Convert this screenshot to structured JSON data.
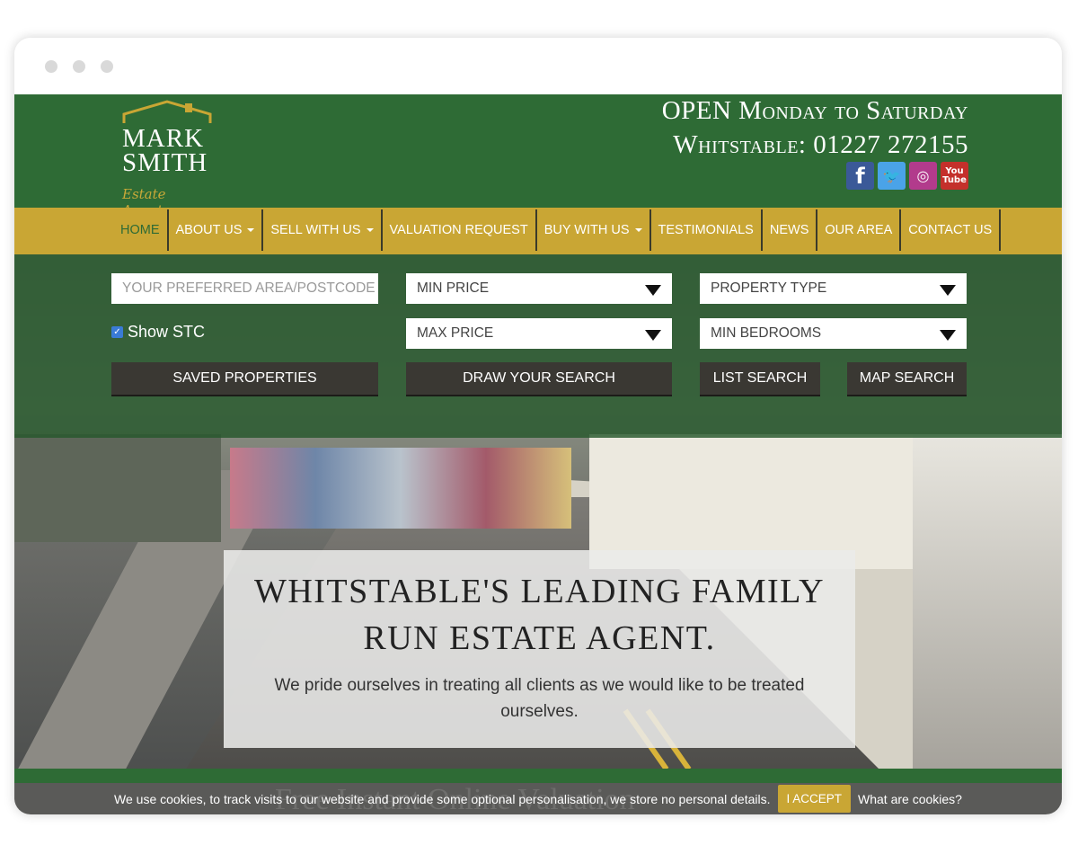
{
  "header": {
    "logo_line1": "MARK",
    "logo_line2": "SMITH",
    "logo_sub": "Estate Agents",
    "open_hours": "OPEN Monday to Saturday",
    "phone": "Whitstable: 01227 272155",
    "socials": [
      "facebook-icon",
      "twitter-icon",
      "instagram-icon",
      "youtube-icon"
    ],
    "brand_green": "#2e6b35",
    "brand_gold": "#c9a634"
  },
  "nav": {
    "items": [
      {
        "label": "HOME"
      },
      {
        "label": "ABOUT US"
      },
      {
        "label": "SELL WITH US"
      },
      {
        "label": "VALUATION REQUEST"
      },
      {
        "label": "BUY WITH US"
      },
      {
        "label": "TESTIMONIALS"
      },
      {
        "label": "NEWS"
      },
      {
        "label": "OUR AREA"
      },
      {
        "label": "CONTACT US"
      }
    ]
  },
  "search": {
    "area_placeholder": "YOUR PREFERRED AREA/POSTCODE",
    "min_price": "MIN PRICE",
    "max_price": "MAX PRICE",
    "property_type": "PROPERTY TYPE",
    "min_bedrooms": "MIN BEDROOMS",
    "show_stc": "Show STC",
    "saved_properties": "SAVED PROPERTIES",
    "draw_search": "DRAW YOUR SEARCH",
    "list_search": "LIST SEARCH",
    "map_search": "MAP SEARCH"
  },
  "hero": {
    "title_line1": "WHITSTABLE'S LEADING FAMILY",
    "title_line2": "RUN ESTATE AGENT.",
    "subtitle": "We pride ourselves in treating all clients as we would like to be treated ourselves."
  },
  "cookie": {
    "ghost_text": "Free Instant Online Valuation",
    "message": "We use cookies, to track visits to our website and provide some optional personalisation, we store no personal details.",
    "accept": "I ACCEPT",
    "more": "What are cookies?"
  }
}
